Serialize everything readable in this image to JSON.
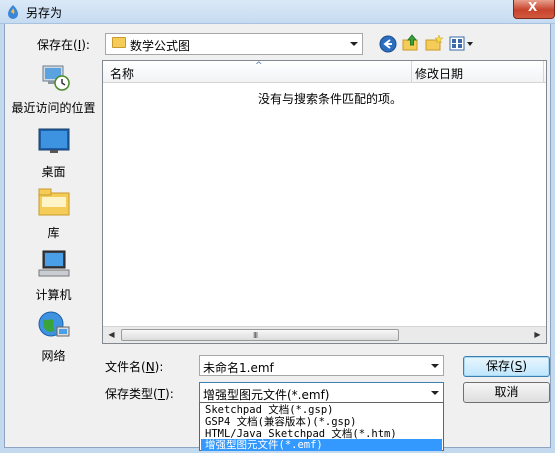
{
  "window": {
    "title": "另存为",
    "close_label": "X"
  },
  "location": {
    "label": "保存在(",
    "hotkey": "I",
    "label_end": "):",
    "value": "数学公式图"
  },
  "places": [
    {
      "label": "最近访问的位置",
      "icon": "recent-places-icon"
    },
    {
      "label": "桌面",
      "icon": "desktop-icon"
    },
    {
      "label": "库",
      "icon": "library-icon"
    },
    {
      "label": "计算机",
      "icon": "computer-icon"
    },
    {
      "label": "网络",
      "icon": "network-icon"
    }
  ],
  "file_list": {
    "columns": [
      "名称",
      "修改日期"
    ],
    "empty_message": "没有与搜索条件匹配的项。",
    "scroll_grip": "III"
  },
  "filename": {
    "label": "文件名(",
    "hotkey": "N",
    "label_end": "):",
    "value": "未命名1.emf"
  },
  "filetype": {
    "label": "保存类型(",
    "hotkey": "T",
    "label_end": "):",
    "value": "增强型图元文件(*.emf)"
  },
  "buttons": {
    "save": "保存(",
    "save_hotkey": "S",
    "save_end": ")",
    "cancel": "取消"
  },
  "filetype_options": [
    "Sketchpad 文档(*.gsp)",
    "GSP4 文档(兼容版本)(*.gsp)",
    "HTML/Java  Sketchpad 文档(*.htm)",
    "增强型图元文件(*.emf)"
  ],
  "colors": {
    "accent": "#3399ff",
    "folder": "#f4cc57"
  }
}
